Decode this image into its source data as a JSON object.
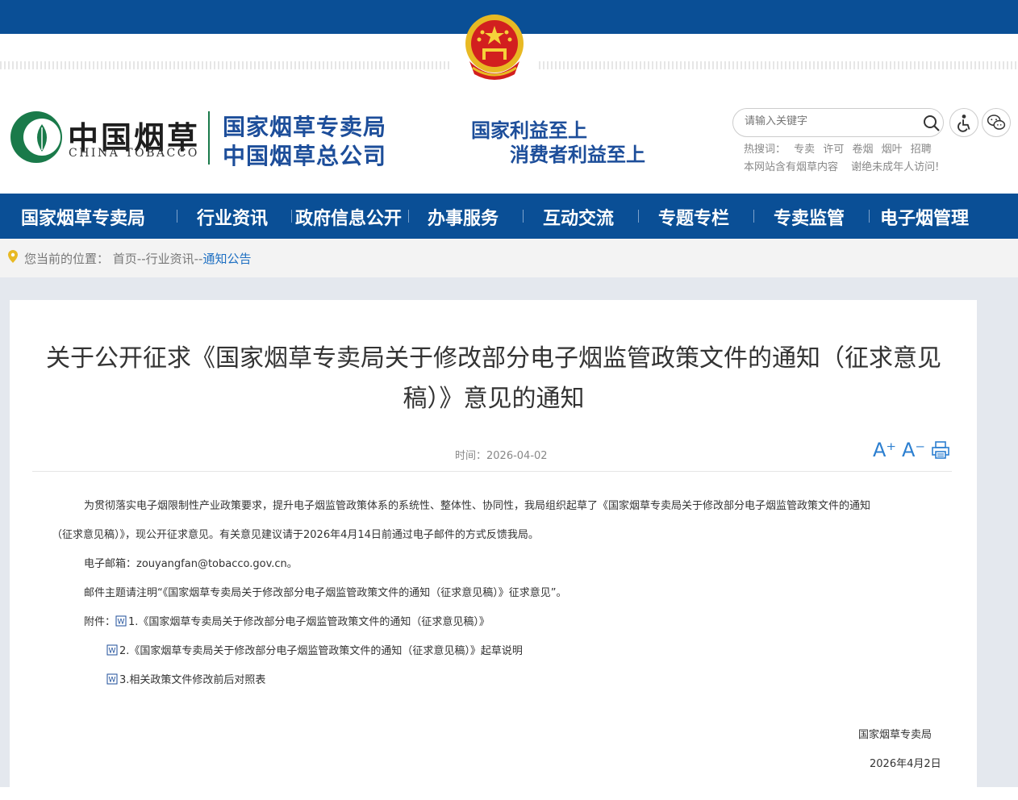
{
  "header": {
    "logo_cn": "中国烟草",
    "logo_en": "CHINA TOBACCO",
    "org_line1": "国家烟草专卖局",
    "org_line2": "中国烟草总公司",
    "slogan_line1": "国家利益至上",
    "slogan_line2": "消费者利益至上",
    "search_placeholder": "请输入关键字",
    "hot_label": "热搜词：",
    "hot_words": [
      "专卖",
      "许可",
      "卷烟",
      "烟叶",
      "招聘"
    ],
    "notice1": "本网站含有烟草内容",
    "notice2": "谢绝未成年人访问!"
  },
  "nav": {
    "items": [
      "国家烟草专卖局",
      "行业资讯",
      "政府信息公开",
      "办事服务",
      "互动交流",
      "专题专栏",
      "专卖监管",
      "电子烟管理"
    ]
  },
  "breadcrumb": {
    "label": "您当前的位置：",
    "path": "首页--行业资讯--",
    "current": "通知公告"
  },
  "article": {
    "title": "关于公开征求《国家烟草专卖局关于修改部分电子烟监管政策文件的通知（征求意见稿）》意见的通知",
    "date": "时间：2026-04-02",
    "para1_line1": "为贯彻落实电子烟限制性产业政策要求，提升电子烟监管政策体系的系统性、整体性、协同性，我局组织起草了《国家烟草专卖局关于修改部分电子烟监管政策文件的通知",
    "para1_line2": "（征求意见稿）》，现公开征求意见。有关意见建议请于2026年4月14日前通过电子邮件的方式反馈我局。",
    "email": "电子邮箱：zouyangfan@tobacco.gov.cn。",
    "subject": "邮件主题请注明“《国家烟草专卖局关于修改部分电子烟监管政策文件的通知（征求意见稿）》征求意见”。",
    "attach_label": "附件：",
    "attachments": [
      "1.《国家烟草专卖局关于修改部分电子烟监管政策文件的通知（征求意见稿）》",
      "2.《国家烟草专卖局关于修改部分电子烟监管政策文件的通知（征求意见稿）》起草说明",
      "3.相关政策文件修改前后对照表"
    ],
    "signature": "国家烟草专卖局",
    "sign_date": "2026年4月2日",
    "font_large": "A⁺",
    "font_small": "A⁻"
  },
  "colors": {
    "primary_blue": "#0a4f96",
    "title_blue": "#1d4e9a",
    "logo_green": "#1a7a4a",
    "link_blue": "#1d6fc2"
  }
}
